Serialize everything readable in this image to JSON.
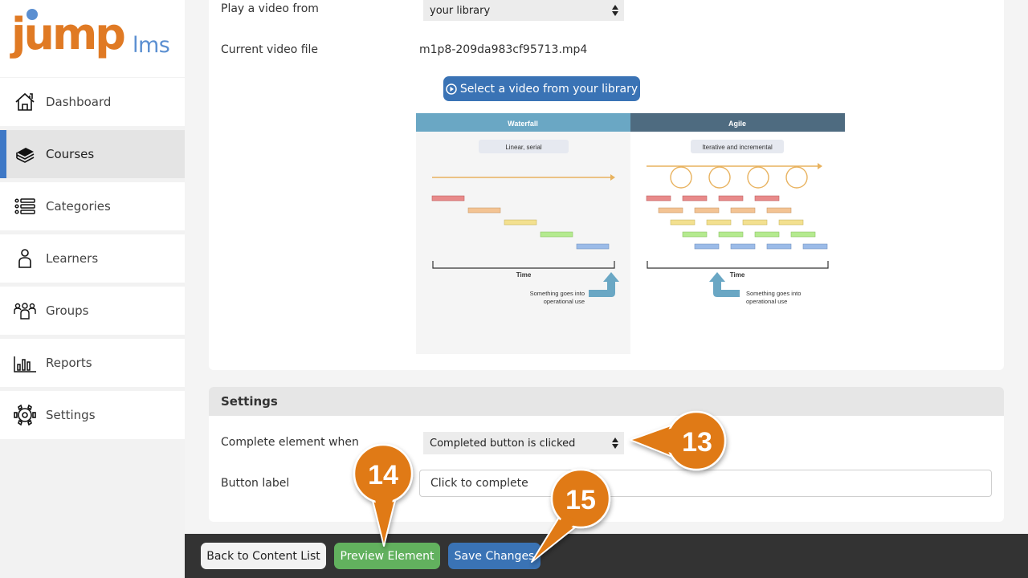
{
  "brand": {
    "name_main": "jump",
    "name_suffix": "lms",
    "primary_color": "#e07a24",
    "accent_color": "#5b8fd1"
  },
  "sidebar": {
    "active": "Courses",
    "items": [
      {
        "label": "Dashboard",
        "icon": "home-icon"
      },
      {
        "label": "Courses",
        "icon": "books-icon"
      },
      {
        "label": "Categories",
        "icon": "list-icon"
      },
      {
        "label": "Learners",
        "icon": "user-icon"
      },
      {
        "label": "Groups",
        "icon": "group-icon"
      },
      {
        "label": "Reports",
        "icon": "bar-chart-icon"
      },
      {
        "label": "Settings",
        "icon": "gear-icon"
      }
    ]
  },
  "video": {
    "play_from_label": "Play a video from",
    "play_from_value": "your library",
    "current_file_label": "Current video file",
    "current_file_value": "m1p8-209da983cf95713.mp4",
    "select_button": "Select a video from your library"
  },
  "diagram": {
    "waterfall": {
      "title": "Waterfall",
      "tag": "Linear, serial",
      "axis_label": "Time",
      "note_line1": "Something goes into",
      "note_line2": "operational use"
    },
    "agile": {
      "title": "Agile",
      "tag": "Iterative and incremental",
      "axis_label": "Time",
      "note_line1": "Something goes into",
      "note_line2": "operational use"
    },
    "phase_colors": [
      "#e88a8a",
      "#f3c393",
      "#f3e08f",
      "#b4ea8f",
      "#9bbbe8"
    ]
  },
  "settings": {
    "heading": "Settings",
    "complete_label": "Complete element when",
    "complete_value": "Completed button is clicked",
    "button_label_label": "Button label",
    "button_label_value": "Click to complete"
  },
  "footer": {
    "back": "Back to Content List",
    "preview": "Preview Element",
    "save": "Save Changes"
  },
  "callouts": [
    {
      "number": "13",
      "target": "complete-element-select"
    },
    {
      "number": "14",
      "target": "preview-element-button"
    },
    {
      "number": "15",
      "target": "save-changes-button"
    }
  ]
}
